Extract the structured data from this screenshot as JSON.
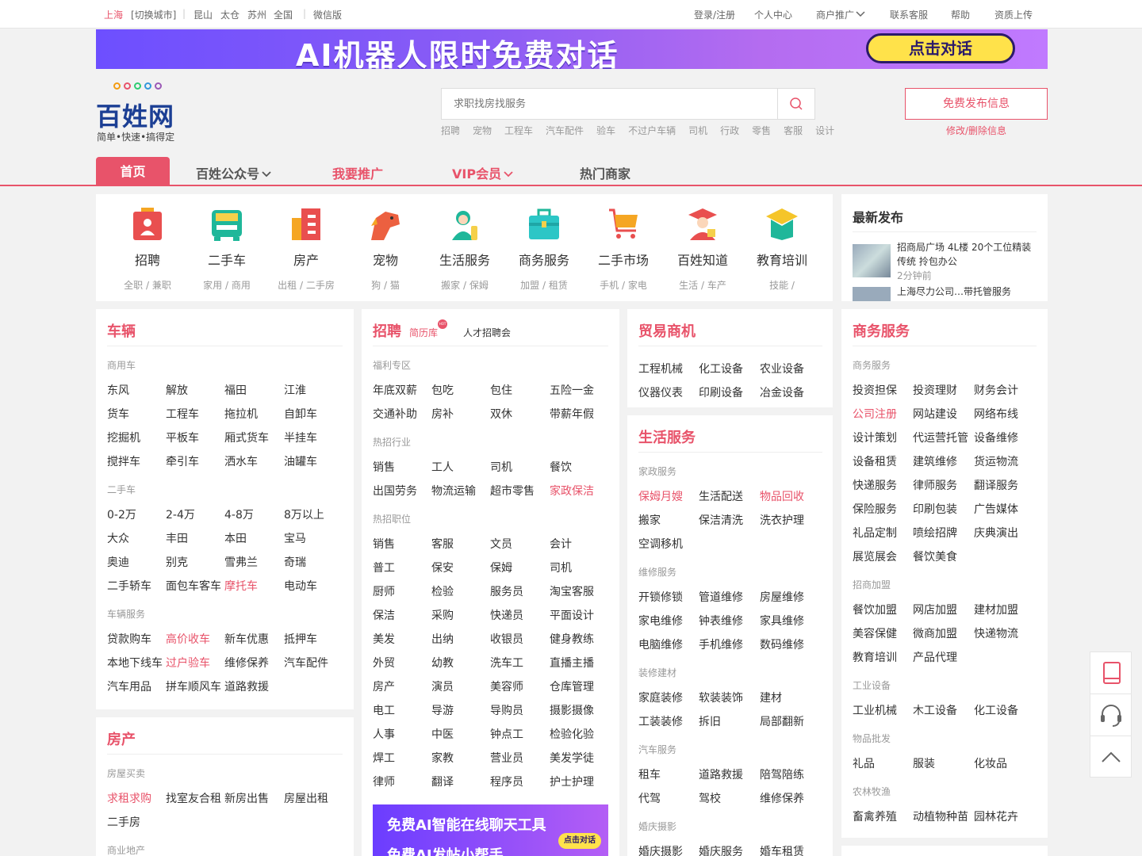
{
  "topbar": {
    "city": "上海",
    "switch_city": "[切换城市]",
    "cities": [
      "昆山",
      "太仓",
      "苏州",
      "全国"
    ],
    "wechat": "微信版",
    "right_links": [
      "登录/注册",
      "个人中心",
      "商户推广",
      "联系客服",
      "帮助",
      "资质上传"
    ]
  },
  "banner": {
    "text": "AI机器人限时免费对话",
    "button": "点击对话"
  },
  "logo": {
    "name": "百姓网",
    "slogan": "简单•快速•搞得定"
  },
  "search": {
    "placeholder": "求职找房找服务",
    "hot": [
      "招聘",
      "宠物",
      "工程车",
      "汽车配件",
      "验车",
      "不过户车辆",
      "司机",
      "行政",
      "零售",
      "客服",
      "设计"
    ]
  },
  "publish": {
    "button": "免费发布信息",
    "edit": "修改/删除信息"
  },
  "nav": {
    "home": "首页",
    "items": [
      "百姓公众号",
      "我要推广",
      "VIP会员",
      "热门商家"
    ]
  },
  "categories": [
    {
      "title": "招聘",
      "sub": "全职 / 兼职"
    },
    {
      "title": "二手车",
      "sub": "家用 / 商用"
    },
    {
      "title": "房产",
      "sub": "出租 / 二手房"
    },
    {
      "title": "宠物",
      "sub": "狗 / 猫"
    },
    {
      "title": "生活服务",
      "sub": "搬家 / 保姆"
    },
    {
      "title": "商务服务",
      "sub": "加盟 / 租赁"
    },
    {
      "title": "二手市场",
      "sub": "手机 / 家电"
    },
    {
      "title": "百姓知道",
      "sub": "生活 / 车产"
    },
    {
      "title": "教育培训",
      "sub": "技能 /"
    }
  ],
  "latest": {
    "title": "最新发布",
    "item1": "招商局广场 4L楼 20个工位精装传统 拎包办公",
    "item1_time": "2分钟前",
    "item2": "上海尽力公司…带托管服务"
  },
  "vehicles": {
    "title": "车辆",
    "groups": [
      {
        "label": "商用车",
        "links": [
          "东风",
          "解放",
          "福田",
          "江淮",
          "货车",
          "工程车",
          "拖拉机",
          "自卸车",
          "挖掘机",
          "平板车",
          "厢式货车",
          "半挂车",
          "搅拌车",
          "牵引车",
          "洒水车",
          "油罐车"
        ]
      },
      {
        "label": "二手车",
        "links": [
          "0-2万",
          "2-4万",
          "4-8万",
          "8万以上",
          "大众",
          "丰田",
          "本田",
          "宝马",
          "奥迪",
          "别克",
          "雪弗兰",
          "奇瑞",
          "二手轿车",
          "面包车客车",
          "摩托车",
          "电动车"
        ]
      },
      {
        "label": "车辆服务",
        "links": [
          "贷款购车",
          "高价收车",
          "新车优惠",
          "抵押车",
          "本地下线车",
          "过户验车",
          "维修保养",
          "汽车配件",
          "汽车用品",
          "拼车顺风车",
          "道路救援"
        ]
      }
    ]
  },
  "house": {
    "title": "房产",
    "groups": [
      {
        "label": "房屋买卖",
        "links": [
          "求租求购",
          "找室友合租",
          "新房出售",
          "房屋出租",
          "二手房"
        ]
      },
      {
        "label": "商业地产",
        "links": []
      }
    ]
  },
  "jobs": {
    "title": "招聘",
    "resume": "简历库",
    "hot_badge": "HOT",
    "fair": "人才招聘会",
    "groups": [
      {
        "label": "福利专区",
        "links": [
          "年底双薪",
          "包吃",
          "包住",
          "五险一金",
          "交通补助",
          "房补",
          "双休",
          "带薪年假"
        ]
      },
      {
        "label": "热招行业",
        "links": [
          "销售",
          "工人",
          "司机",
          "餐饮",
          "出国劳务",
          "物流运输",
          "超市零售",
          "家政保洁"
        ]
      },
      {
        "label": "热招职位",
        "links": [
          "销售",
          "客服",
          "文员",
          "会计",
          "普工",
          "保安",
          "保姆",
          "司机",
          "厨师",
          "检验",
          "服务员",
          "淘宝客服",
          "保洁",
          "采购",
          "快递员",
          "平面设计",
          "美发",
          "出纳",
          "收银员",
          "健身教练",
          "外贸",
          "幼教",
          "洗车工",
          "直播主播",
          "房产",
          "演员",
          "美容师",
          "仓库管理",
          "电工",
          "导游",
          "导购员",
          "摄影摄像",
          "人事",
          "中医",
          "钟点工",
          "检验化验",
          "焊工",
          "家教",
          "营业员",
          "美发学徒",
          "律师",
          "翻译",
          "程序员",
          "护士护理"
        ]
      }
    ],
    "ad_line1": "免费AI智能在线聊天工具",
    "ad_line2": "免费AI发帖小帮手",
    "ad_button": "点击对话"
  },
  "trade": {
    "title": "贸易商机",
    "links": [
      "工程机械",
      "化工设备",
      "农业设备",
      "仪器仪表",
      "印刷设备",
      "冶金设备"
    ]
  },
  "life": {
    "title": "生活服务",
    "groups": [
      {
        "label": "家政服务",
        "links": [
          "保姆月嫂",
          "生活配送",
          "物品回收",
          "搬家",
          "保洁清洗",
          "洗衣护理",
          "空调移机"
        ]
      },
      {
        "label": "维修服务",
        "links": [
          "开锁修锁",
          "管道维修",
          "房屋维修",
          "家电维修",
          "钟表维修",
          "家具维修",
          "电脑维修",
          "手机维修",
          "数码维修"
        ]
      },
      {
        "label": "装修建材",
        "links": [
          "家庭装修",
          "软装装饰",
          "建材",
          "工装装修",
          "拆旧",
          "局部翻新"
        ]
      },
      {
        "label": "汽车服务",
        "links": [
          "租车",
          "道路救援",
          "陪驾陪练",
          "代驾",
          "驾校",
          "维修保养"
        ]
      },
      {
        "label": "婚庆摄影",
        "links": [
          "婚庆摄影",
          "婚庆服务",
          "婚车租赁"
        ]
      }
    ]
  },
  "business": {
    "title": "商务服务",
    "groups": [
      {
        "label": "商务服务",
        "links": [
          "投资担保",
          "投资理财",
          "财务会计",
          "公司注册",
          "网站建设",
          "网络布线",
          "设计策划",
          "代运营托管",
          "设备维修",
          "设备租赁",
          "建筑维修",
          "货运物流",
          "快递服务",
          "律师服务",
          "翻译服务",
          "保险服务",
          "印刷包装",
          "广告媒体",
          "礼品定制",
          "喷绘招牌",
          "庆典演出",
          "展览展会",
          "餐饮美食"
        ]
      },
      {
        "label": "招商加盟",
        "links": [
          "餐饮加盟",
          "网店加盟",
          "建材加盟",
          "美容保健",
          "微商加盟",
          "快递物流",
          "教育培训",
          "产品代理"
        ]
      },
      {
        "label": "工业设备",
        "links": [
          "工业机械",
          "木工设备",
          "化工设备"
        ]
      },
      {
        "label": "物品批发",
        "links": [
          "礼品",
          "服装",
          "化妆品"
        ]
      },
      {
        "label": "农林牧渔",
        "links": [
          "畜禽养殖",
          "动植物种苗",
          "园林花卉"
        ]
      }
    ]
  },
  "colors": {
    "accent": "#e8536a",
    "brand": "#1c3f94"
  }
}
